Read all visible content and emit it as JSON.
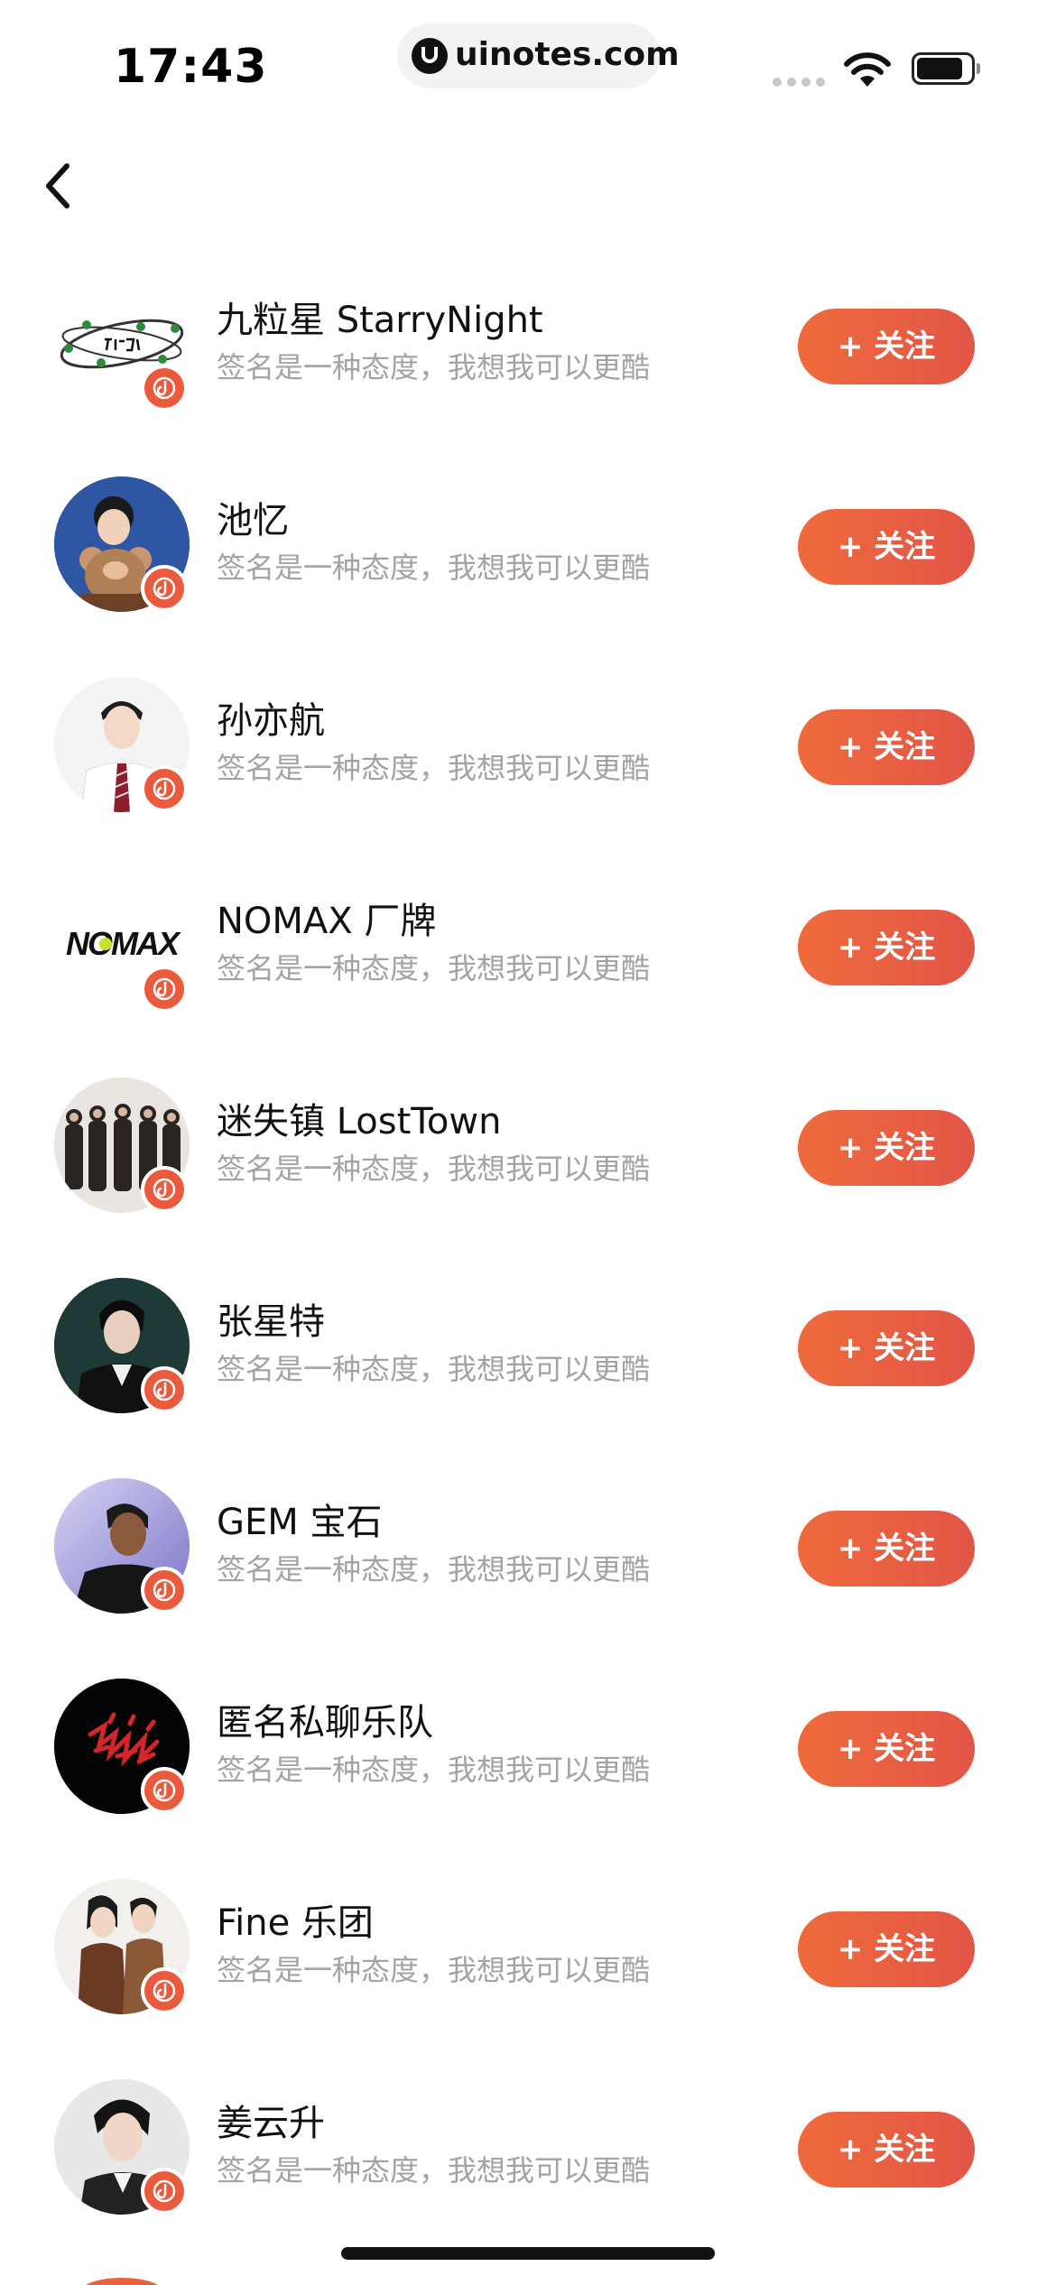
{
  "status_bar": {
    "time": "17:43",
    "url": "uinotes.com",
    "icons": [
      "signal-icon",
      "wifi-icon",
      "battery-icon"
    ]
  },
  "nav": {
    "back_icon": "chevron-left-icon"
  },
  "colors": {
    "accent": "#ea5a3c",
    "button_gradient_start": "#ef6b3c",
    "button_gradient_end": "#e25547",
    "name_text": "#111111",
    "bio_text": "#a3a3a3"
  },
  "follow_label": "+ 关注",
  "bio": "签名是一种态度，我想我可以更酷",
  "users": [
    {
      "name": "九粒星 StarryNight",
      "avatar": "starry-night-logo"
    },
    {
      "name": "池忆",
      "avatar": "photo-portrait"
    },
    {
      "name": "孙亦航",
      "avatar": "photo-portrait"
    },
    {
      "name": "NOMAX 厂牌",
      "avatar": "nomax-logo"
    },
    {
      "name": "迷失镇 LostTown",
      "avatar": "band-photo"
    },
    {
      "name": "张星特",
      "avatar": "photo-portrait"
    },
    {
      "name": "GEM 宝石",
      "avatar": "photo-portrait"
    },
    {
      "name": "匿名私聊乐队",
      "avatar": "band-logo"
    },
    {
      "name": "Fine 乐团",
      "avatar": "band-photo"
    },
    {
      "name": "姜云升",
      "avatar": "photo-portrait"
    }
  ]
}
